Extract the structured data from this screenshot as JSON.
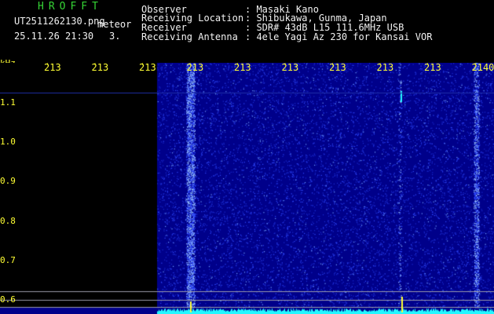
{
  "header": {
    "app_title": "HROFFT",
    "file_name": "UT2511262130.png",
    "meteor_label": "meteor",
    "date_time": "25.11.26 21:30",
    "count_value": "3."
  },
  "info": {
    "rows": [
      {
        "label": "Observer",
        "value": ": Masaki Kano"
      },
      {
        "label": "Receiving Location",
        "value": ": Shibukawa, Gunma, Japan"
      },
      {
        "label": "Receiver",
        "value": ": SDR# 43dB L15 111.6MHz USB"
      },
      {
        "label": "Receiving Antenna",
        "value": ": 4ele Yagi Az 230 for Kansai VOR"
      }
    ]
  },
  "chart_data": {
    "type": "heatmap",
    "y_unit_label": "kHz",
    "x_tick_labels": [
      "213",
      "213",
      "213",
      "213",
      "213",
      "213",
      "213",
      "213",
      "213",
      "2140"
    ],
    "y_tick_labels": [
      "1.1",
      "1.0",
      "0.9",
      "0.8",
      "0.7",
      "0.6"
    ],
    "colors": {
      "background": "#00008a",
      "noise": "#2f49ff",
      "signal": "#23f7ff",
      "axis": "#ffff33"
    }
  }
}
